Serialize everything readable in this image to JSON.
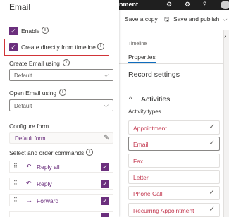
{
  "topbar": {
    "app_title": "nment",
    "avatar_initials": ""
  },
  "cmdbar": {
    "save_copy": "Save a copy",
    "save_publish": "Save and publish",
    "publish_chevron": "⌵"
  },
  "timeline": {
    "section_label": "Timeline",
    "tab_properties": "Properties",
    "record_settings": "Record settings",
    "activities_heading": "Activities",
    "activity_types_label": "Activity types",
    "activity_types": [
      {
        "label": "Appointment",
        "checked": true
      },
      {
        "label": "Email",
        "checked": true
      },
      {
        "label": "Fax",
        "checked": false
      },
      {
        "label": "Letter",
        "checked": false
      },
      {
        "label": "Phone Call",
        "checked": true
      },
      {
        "label": "Recurring Appointment",
        "checked": true
      }
    ]
  },
  "panel": {
    "title": "Email",
    "enable_label": "Enable",
    "create_from_timeline_label": "Create directly from timeline",
    "create_email_using_label": "Create Email using",
    "create_email_using_value": "Default",
    "open_email_using_label": "Open Email using",
    "open_email_using_value": "Default",
    "configure_form_label": "Configure form",
    "configure_form_value": "Default form",
    "commands_label": "Select and order commands",
    "commands": [
      {
        "label": "Reply all",
        "checked": true
      },
      {
        "label": "Reply",
        "checked": true
      },
      {
        "label": "Forward",
        "checked": true
      }
    ]
  },
  "colors": {
    "accent": "#6b2f7d",
    "highlight": "#d13438",
    "link": "#c3384f"
  }
}
